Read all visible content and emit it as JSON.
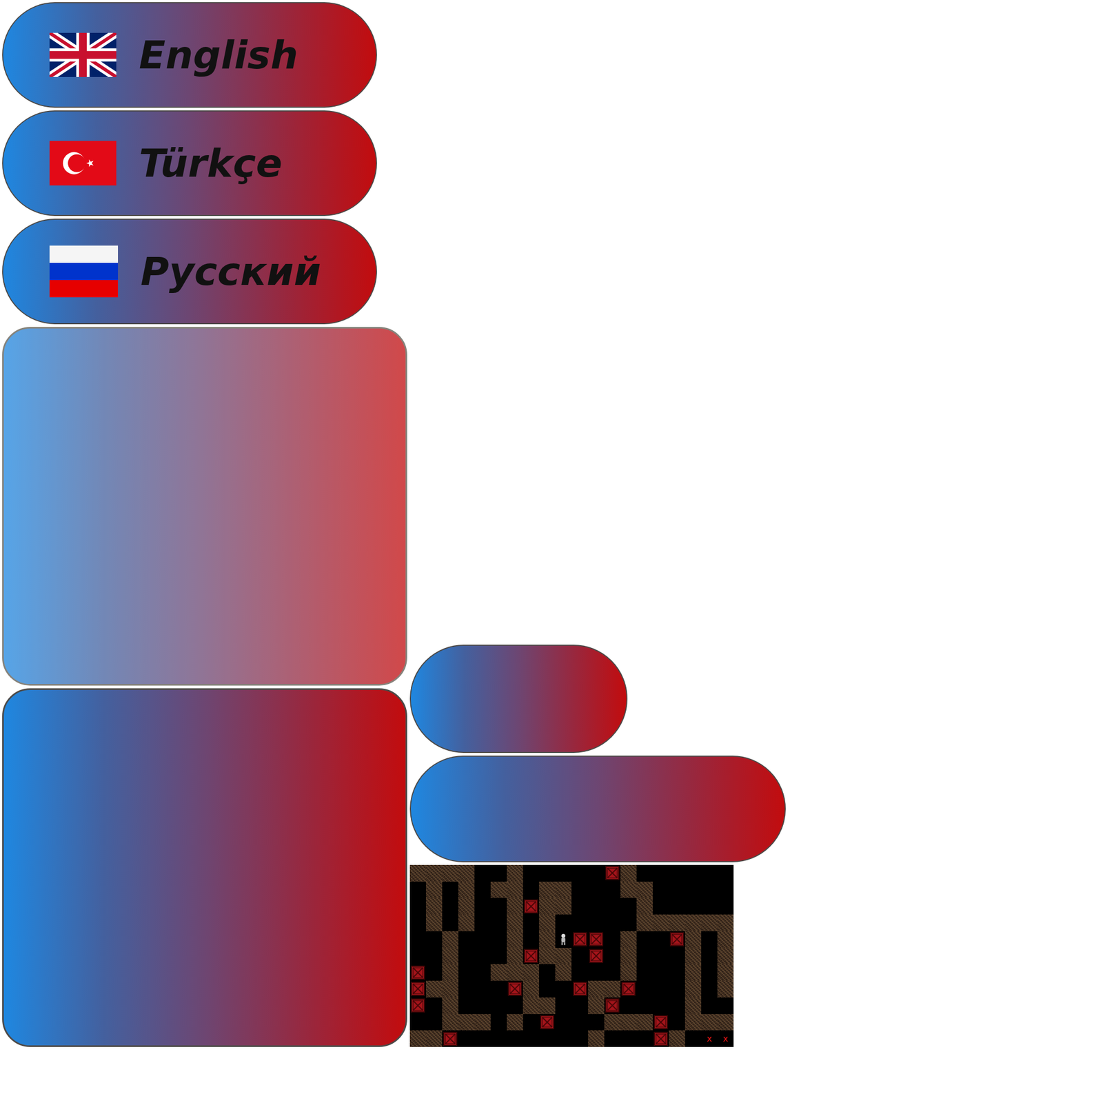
{
  "language_buttons": [
    {
      "label": "English",
      "kind": "uk"
    },
    {
      "label": "Türkçe",
      "kind": "tr"
    },
    {
      "label": "Русский",
      "kind": "ru"
    }
  ],
  "level_map": {
    "rows": [
      "####..#.....X#......",
      ".#.#.##.##...##.....",
      ".#.#..#X##....#.....",
      ".#.#..#.#.....######",
      "..#...#.#PXX.#..X#.#",
      "..#...#X##.X.#...#.#",
      "X.#..###.#...#...#.#",
      "X##...X#..X##X...#.#",
      "X.#....##..#X....#..",
      "..###.#.X...###X.###",
      "##X........#...X#.xx"
    ]
  }
}
